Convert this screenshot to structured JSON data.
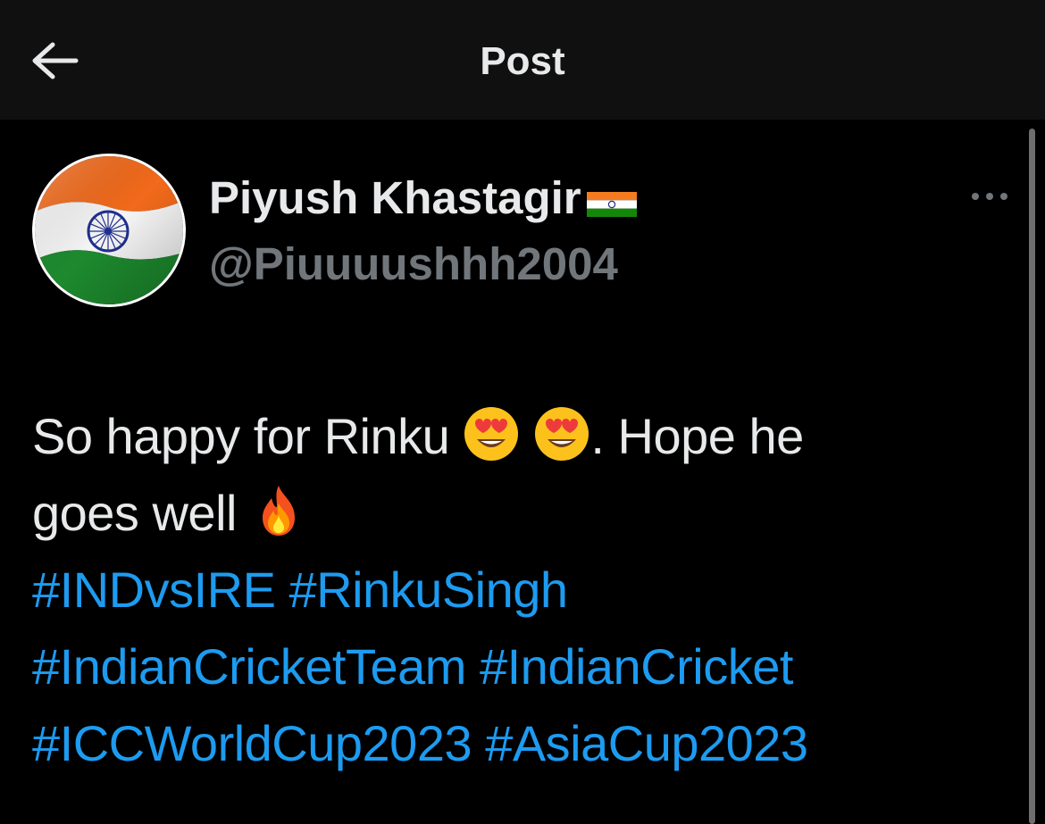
{
  "header": {
    "title": "Post",
    "back_icon": "arrow-left-icon"
  },
  "author": {
    "display_name": "Piyush Khastagir",
    "name_emoji": "india-flag-icon",
    "handle": "@Piuuuushhh2004",
    "avatar": "india-flag-avatar"
  },
  "post": {
    "line1_text": "So happy for Rinku ",
    "line1_after_emoji": ". Hope he",
    "line2_text": "goes well ",
    "hashtags": [
      "#INDvsIRE",
      "#RinkuSingh",
      "#IndianCricketTeam",
      "#IndianCricket",
      "#ICCWorldCup2023",
      "#AsiaCup2023"
    ]
  },
  "colors": {
    "background": "#000000",
    "header_bg": "#101010",
    "text": "#e7e9ea",
    "secondary": "#71767b",
    "link": "#1d9bf0"
  }
}
